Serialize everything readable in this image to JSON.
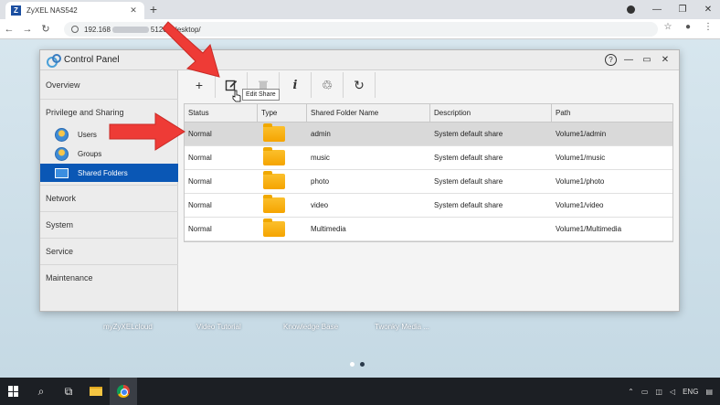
{
  "browser": {
    "tab_title": "ZyXEL NAS542",
    "tab_favicon_letter": "Z",
    "url_prefix": "192.168",
    "url_suffix": "51209/desktop/"
  },
  "window": {
    "title": "Control Panel"
  },
  "sidebar": {
    "items": [
      {
        "label": "Overview"
      },
      {
        "label": "Privilege and Sharing"
      },
      {
        "label": "Network"
      },
      {
        "label": "System"
      },
      {
        "label": "Service"
      },
      {
        "label": "Maintenance"
      }
    ],
    "subitems": [
      {
        "label": "Users"
      },
      {
        "label": "Groups"
      },
      {
        "label": "Shared Folders"
      }
    ]
  },
  "toolbar": {
    "add_symbol": "+",
    "info_symbol": "i",
    "recycle_symbol": "♲",
    "refresh_symbol": "↻",
    "tooltip": "Edit Share"
  },
  "grid": {
    "headers": [
      "Status",
      "Type",
      "Shared Folder Name",
      "Description",
      "Path"
    ],
    "rows": [
      {
        "status": "Normal",
        "name": "admin",
        "description": "System default share",
        "path": "Volume1/admin"
      },
      {
        "status": "Normal",
        "name": "music",
        "description": "System default share",
        "path": "Volume1/music"
      },
      {
        "status": "Normal",
        "name": "photo",
        "description": "System default share",
        "path": "Volume1/photo"
      },
      {
        "status": "Normal",
        "name": "video",
        "description": "System default share",
        "path": "Volume1/video"
      },
      {
        "status": "Normal",
        "name": "Multimedia",
        "description": "",
        "path": "Volume1/Multimedia"
      }
    ]
  },
  "desktop": {
    "labels": [
      "myZyXELcloud",
      "Video Tutorial",
      "Knowledge Base",
      "Twonky Media ..."
    ]
  },
  "taskbar": {
    "language": "ENG"
  },
  "colors": {
    "accent": "#0a57b5",
    "arrow": "#ee3b36",
    "folder": "#f5a400"
  }
}
